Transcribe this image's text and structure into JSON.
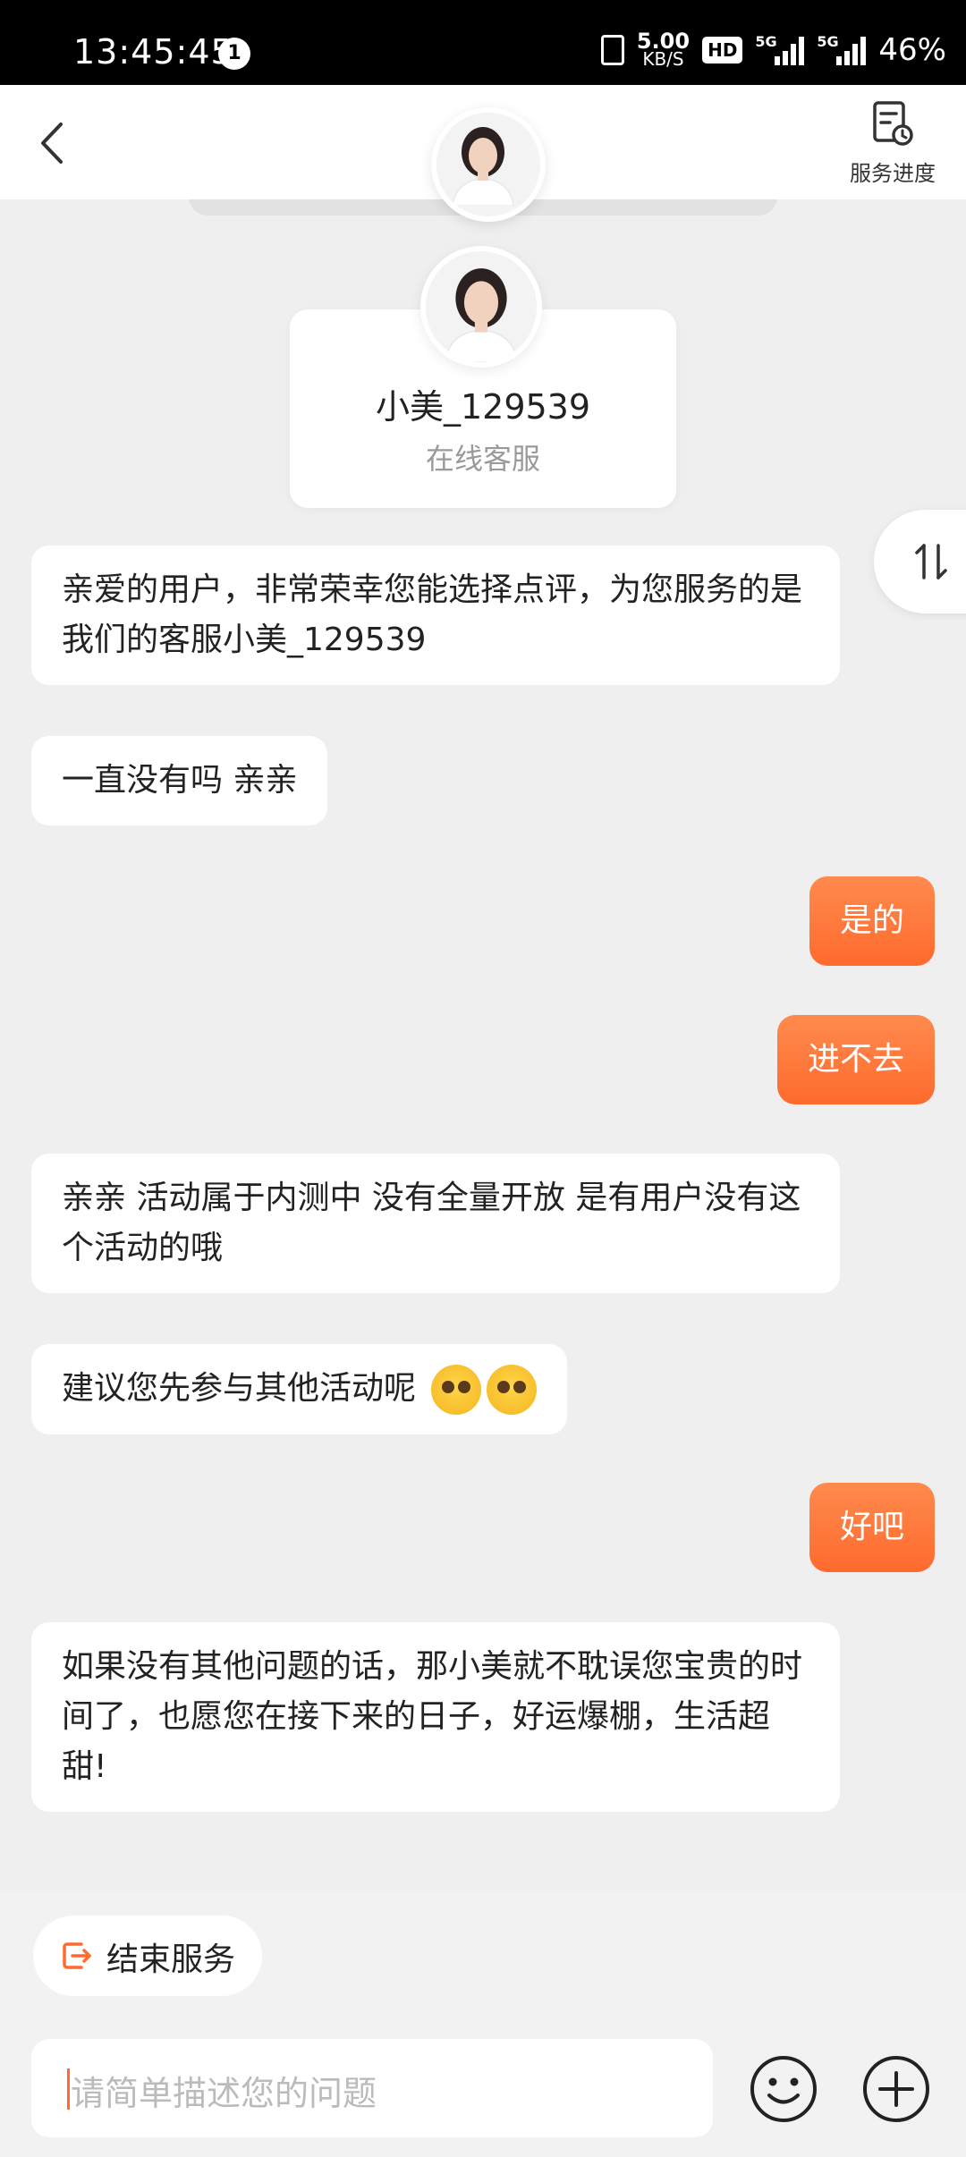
{
  "status_bar": {
    "time": "13:45:45",
    "notification_count": "1",
    "net_speed_value": "5.00",
    "net_speed_unit": "KB/S",
    "hd_label": "HD",
    "signal_1_label": "5G",
    "signal_2_label": "5G",
    "battery": "46%"
  },
  "header": {
    "progress_label": "服务进度",
    "back_icon": "chevron-left-icon",
    "progress_icon": "document-clock-icon"
  },
  "agent_card": {
    "name": "小美_129539",
    "role": "在线客服"
  },
  "messages": [
    {
      "side": "in",
      "text": "亲爱的用户，非常荣幸您能选择点评，为您服务的是我们的客服小美_129539"
    },
    {
      "side": "in",
      "text": "一直没有吗 亲亲"
    },
    {
      "side": "out",
      "text": "是的"
    },
    {
      "side": "out",
      "text": "进不去"
    },
    {
      "side": "in",
      "text": "亲亲 活动属于内测中 没有全量开放 是有用户没有这个活动的哦"
    },
    {
      "side": "in",
      "text": "建议您先参与其他活动呢"
    },
    {
      "side": "out",
      "text": "好吧"
    },
    {
      "side": "in",
      "text": "如果没有其他问题的话，那小美就不耽误您宝贵的时间了，也愿您在接下来的日子，好运爆棚，生活超甜!"
    }
  ],
  "footer": {
    "end_service_label": "结束服务",
    "input_placeholder": "请简单描述您的问题"
  },
  "colors": {
    "accent": "#ff6a2e",
    "page_bg": "#efefef"
  }
}
